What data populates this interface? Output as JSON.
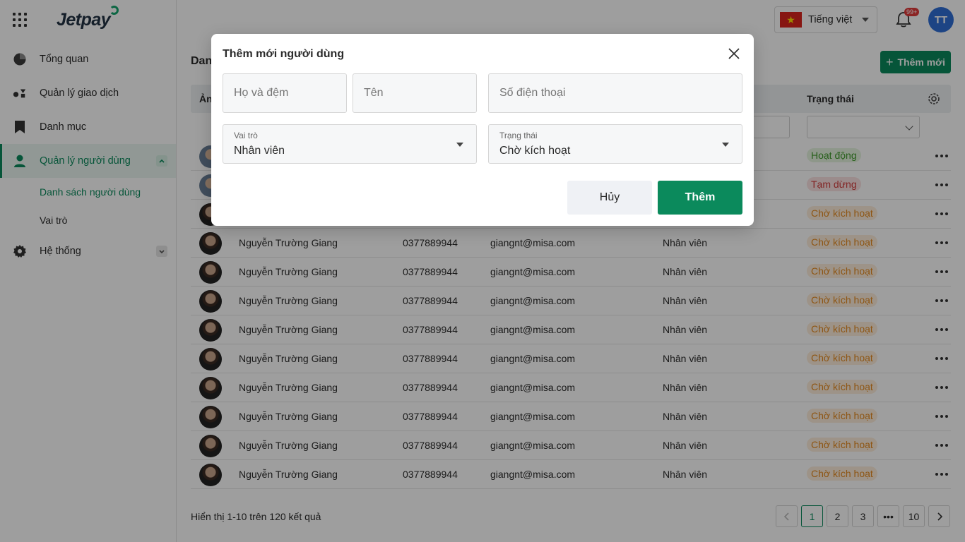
{
  "app": {
    "logo": "Jetpay"
  },
  "sidebar": {
    "items": [
      {
        "label": "Tổng quan"
      },
      {
        "label": "Quản lý giao dịch"
      },
      {
        "label": "Danh mục"
      },
      {
        "label": "Quản lý người dùng"
      },
      {
        "label": "Hệ thống"
      }
    ],
    "subitems": [
      {
        "label": "Danh sách người dùng"
      },
      {
        "label": "Vai trò"
      }
    ]
  },
  "header": {
    "language": "Tiếng việt",
    "notification_badge": "99+",
    "avatar_initials": "TT"
  },
  "main": {
    "title": "Dan",
    "add_button": "Thêm mới",
    "columns": {
      "avatar": "Ản",
      "status": "Trạng thái"
    },
    "status_colors": {
      "active": "#3e9a2a",
      "stopped": "#d23c3c",
      "pending": "#e58a1f"
    },
    "rows": [
      {
        "name": "",
        "phone": "",
        "email": "",
        "role": "",
        "status": "Hoạt động",
        "status_type": "act",
        "avatar": "alt"
      },
      {
        "name": "",
        "phone": "",
        "email": "",
        "role": "",
        "status": "Tạm dừng",
        "status_type": "stop",
        "avatar": "alt"
      },
      {
        "name": "",
        "phone": "",
        "email": "",
        "role": "",
        "status": "Chờ kích hoạt",
        "status_type": "wait",
        "avatar": "dark"
      },
      {
        "name": "Nguyễn Trường Giang",
        "phone": "0377889944",
        "email": "giangnt@misa.com",
        "role": "Nhân viên",
        "status": "Chờ kích hoạt",
        "status_type": "wait",
        "avatar": "dark"
      },
      {
        "name": "Nguyễn Trường Giang",
        "phone": "0377889944",
        "email": "giangnt@misa.com",
        "role": "Nhân viên",
        "status": "Chờ kích hoạt",
        "status_type": "wait",
        "avatar": "dark"
      },
      {
        "name": "Nguyễn Trường Giang",
        "phone": "0377889944",
        "email": "giangnt@misa.com",
        "role": "Nhân viên",
        "status": "Chờ kích hoạt",
        "status_type": "wait",
        "avatar": "dark"
      },
      {
        "name": "Nguyễn Trường Giang",
        "phone": "0377889944",
        "email": "giangnt@misa.com",
        "role": "Nhân viên",
        "status": "Chờ kích hoạt",
        "status_type": "wait",
        "avatar": "dark"
      },
      {
        "name": "Nguyễn Trường Giang",
        "phone": "0377889944",
        "email": "giangnt@misa.com",
        "role": "Nhân viên",
        "status": "Chờ kích hoạt",
        "status_type": "wait",
        "avatar": "dark"
      },
      {
        "name": "Nguyễn Trường Giang",
        "phone": "0377889944",
        "email": "giangnt@misa.com",
        "role": "Nhân viên",
        "status": "Chờ kích hoạt",
        "status_type": "wait",
        "avatar": "dark"
      },
      {
        "name": "Nguyễn Trường Giang",
        "phone": "0377889944",
        "email": "giangnt@misa.com",
        "role": "Nhân viên",
        "status": "Chờ kích hoạt",
        "status_type": "wait",
        "avatar": "dark"
      },
      {
        "name": "Nguyễn Trường Giang",
        "phone": "0377889944",
        "email": "giangnt@misa.com",
        "role": "Nhân viên",
        "status": "Chờ kích hoạt",
        "status_type": "wait",
        "avatar": "dark"
      },
      {
        "name": "Nguyễn Trường Giang",
        "phone": "0377889944",
        "email": "giangnt@misa.com",
        "role": "Nhân viên",
        "status": "Chờ kích hoạt",
        "status_type": "wait",
        "avatar": "dark"
      }
    ],
    "footer_info": "Hiển thị 1-10 trên 120 kết quả",
    "pagination": [
      "1",
      "2",
      "3",
      "•••",
      "10"
    ]
  },
  "modal": {
    "title": "Thêm mới người dùng",
    "placeholders": {
      "last_name": "Họ và đệm",
      "first_name": "Tên",
      "phone": "Số điện thoại"
    },
    "role": {
      "label": "Vai trò",
      "value": "Nhân viên"
    },
    "status": {
      "label": "Trạng thái",
      "value": "Chờ kích hoạt"
    },
    "cancel": "Hủy",
    "submit": "Thêm"
  },
  "colors": {
    "primary": "#0b8a5c",
    "avatar_bg": "#2f6fd6",
    "badge": "#e03a3a"
  }
}
